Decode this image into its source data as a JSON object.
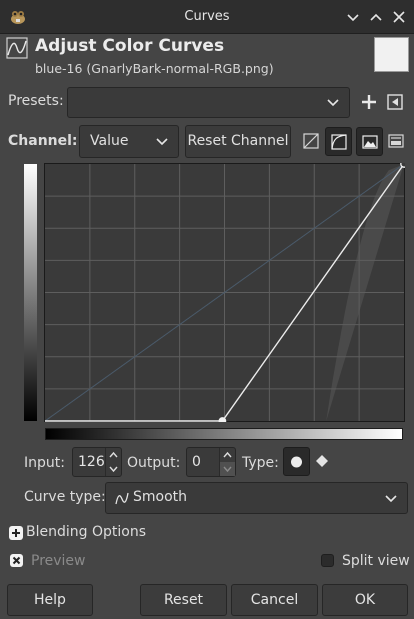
{
  "window": {
    "title": "Curves",
    "app_icon": "gimp-icon",
    "controls": [
      "chevron-down-icon",
      "chevron-up-icon",
      "close-icon"
    ]
  },
  "header": {
    "icon": "curves-icon",
    "title": "Adjust Color Curves",
    "subtitle": "blue-16 (GnarlyBark-normal-RGB.png)"
  },
  "presets": {
    "label": "Presets:",
    "value": "",
    "add_icon": "plus-icon",
    "menu_icon": "menu-arrow-icon"
  },
  "channel": {
    "label": "Channel:",
    "value": "Value",
    "reset_label": "Reset Channel",
    "mode_icons": [
      "linear-histogram-icon",
      "log-histogram-icon",
      "image-histogram-icon",
      "image-bars-icon"
    ]
  },
  "curve": {
    "points": [
      [
        126,
        0
      ],
      [
        255,
        255
      ]
    ],
    "input_range": [
      0,
      255
    ],
    "output_range": [
      0,
      255
    ],
    "grid_divisions": 8,
    "bg_color": "#3a3a3a",
    "histogram_color": "#4a4a4a",
    "curve_color": "#ececec"
  },
  "controls": {
    "input_label": "Input:",
    "input_value": "126",
    "output_label": "Output:",
    "output_value": "0",
    "type_label": "Type:",
    "type_icons": [
      "smooth-point-icon",
      "corner-point-icon"
    ]
  },
  "curve_type": {
    "label": "Curve type:",
    "value": "Smooth",
    "icon": "smooth-curve-icon"
  },
  "blending": {
    "label": "Blending Options"
  },
  "preview": {
    "label": "Preview",
    "checked": true
  },
  "split_view": {
    "label": "Split view",
    "checked": false
  },
  "buttons": {
    "help": "Help",
    "reset": "Reset",
    "cancel": "Cancel",
    "ok": "OK"
  }
}
